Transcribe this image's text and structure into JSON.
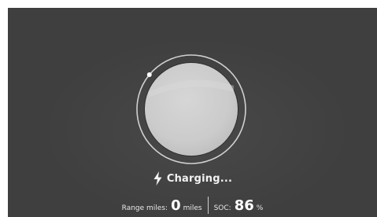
{
  "charging": {
    "status_text": "Charging...",
    "state_of_charge_percent": 86
  },
  "range": {
    "label": "Range miles:",
    "value": "0",
    "unit": "miles"
  },
  "soc": {
    "label": "SOC:",
    "value": "86",
    "unit": "%"
  },
  "colors": {
    "background": "#3f3f3f",
    "ring": "#d9d9d9",
    "disc": "#cfcfcf",
    "text": "#ffffff"
  },
  "icons": {
    "status": "lightning-bolt-icon",
    "progress_marker": "progress-dot-icon"
  }
}
